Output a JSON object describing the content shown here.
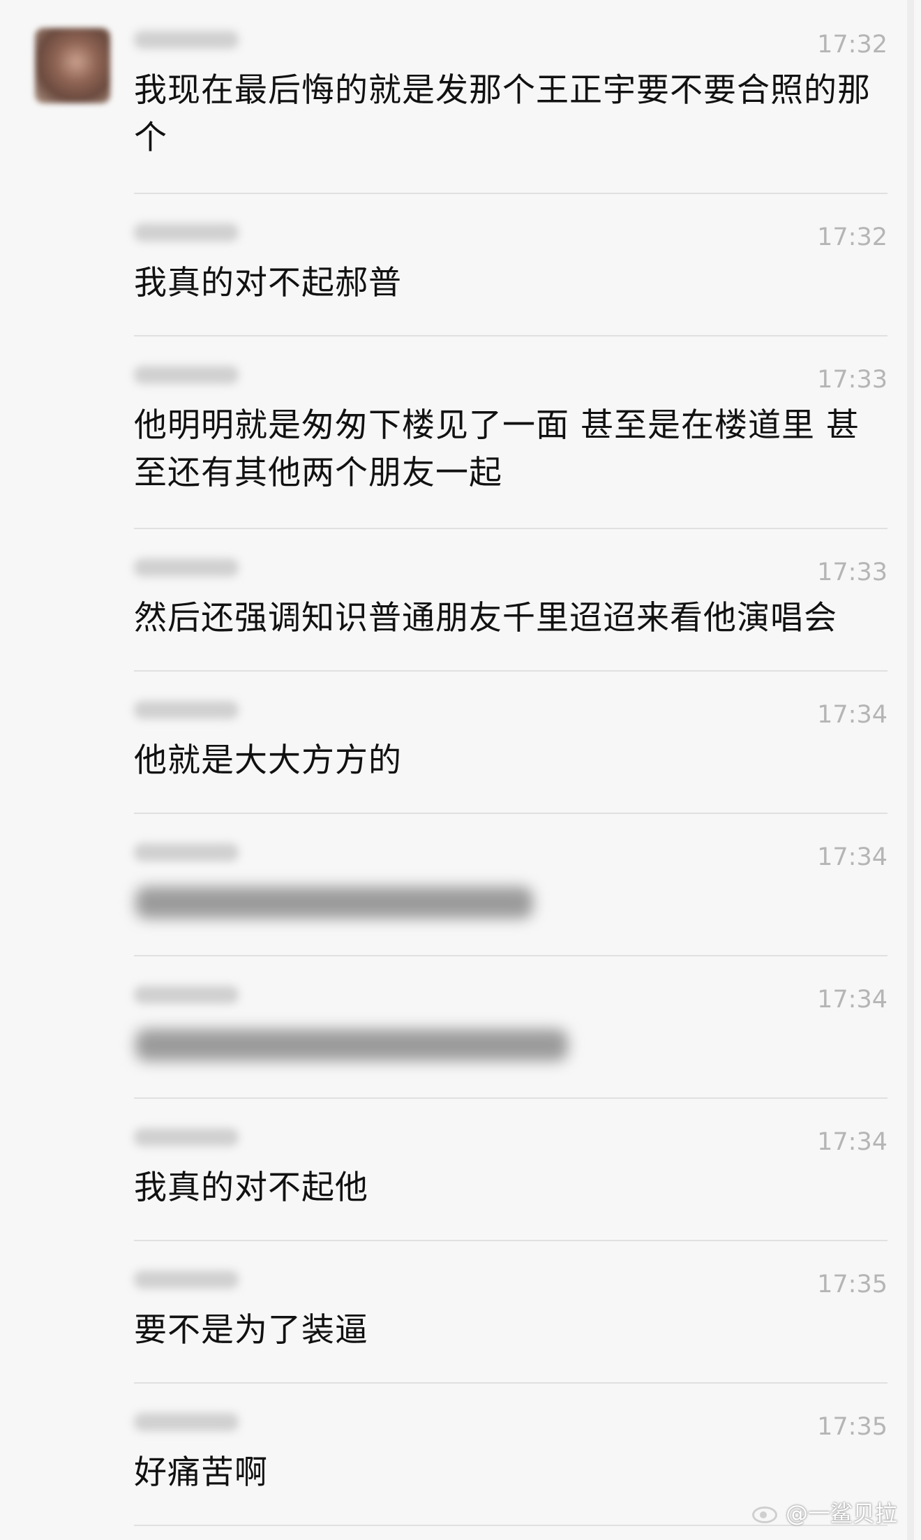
{
  "messages": [
    {
      "time": "17:32",
      "text": "我现在最后悔的就是发那个王正宇要不要合照的那个",
      "blurred": false
    },
    {
      "time": "17:32",
      "text": "我真的对不起郝普",
      "blurred": false
    },
    {
      "time": "17:33",
      "text": "他明明就是匆匆下楼见了一面 甚至是在楼道里 甚至还有其他两个朋友一起",
      "blurred": false
    },
    {
      "time": "17:33",
      "text": "然后还强调知识普通朋友千里迢迢来看他演唱会",
      "blurred": false
    },
    {
      "time": "17:34",
      "text": "他就是大大方方的",
      "blurred": false
    },
    {
      "time": "17:34",
      "text": "",
      "blurred": true
    },
    {
      "time": "17:34",
      "text": "",
      "blurred": true
    },
    {
      "time": "17:34",
      "text": "我真的对不起他",
      "blurred": false
    },
    {
      "time": "17:35",
      "text": "要不是为了装逼",
      "blurred": false
    },
    {
      "time": "17:35",
      "text": "好痛苦啊",
      "blurred": false
    }
  ],
  "watermark": {
    "text": "@一鲨贝拉",
    "icon": "weibo-icon"
  }
}
